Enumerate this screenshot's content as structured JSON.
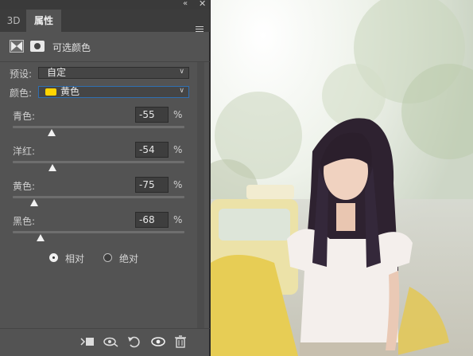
{
  "tabs": [
    "3D",
    "属性"
  ],
  "header": {
    "title": "可选颜色"
  },
  "preset": {
    "label": "预设:",
    "value": "自定"
  },
  "color": {
    "label": "颜色:",
    "value": "黄色",
    "swatch": "#ffd400"
  },
  "sliders": [
    {
      "label": "青色:",
      "value": "-55",
      "unit": "%",
      "level": -55
    },
    {
      "label": "洋红:",
      "value": "-54",
      "unit": "%",
      "level": -54
    },
    {
      "label": "黄色:",
      "value": "-75",
      "unit": "%",
      "level": -75
    },
    {
      "label": "黑色:",
      "value": "-68",
      "unit": "%",
      "level": -68
    }
  ],
  "method": {
    "relative": "相对",
    "absolute": "绝对",
    "selected": "relative"
  },
  "footer_icons": [
    "clip-to-layer-icon",
    "view-previous-icon",
    "reset-icon",
    "visibility-eye-icon",
    "trash-icon"
  ],
  "photo": {
    "subject": "girl-long-hair-photo"
  }
}
